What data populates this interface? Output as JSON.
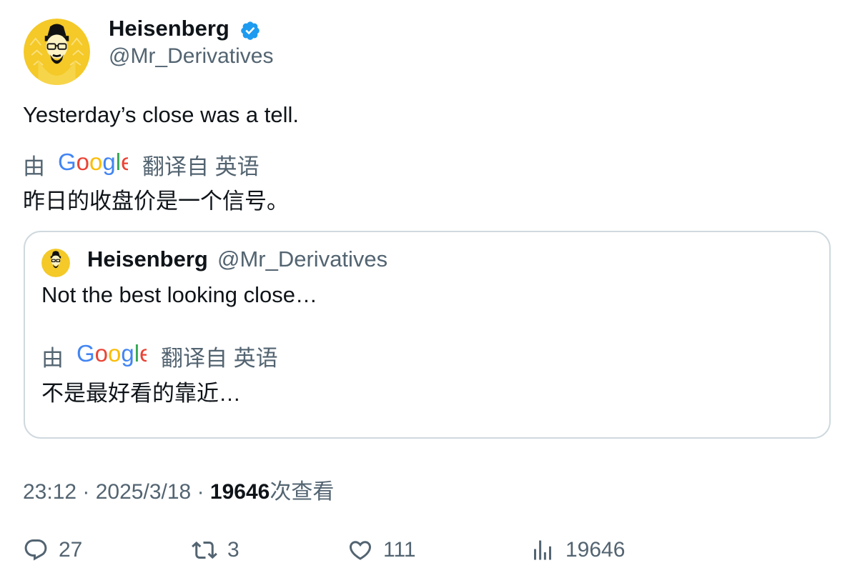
{
  "author": {
    "name": "Heisenberg",
    "handle": "@Mr_Derivatives"
  },
  "tweet": {
    "text": "Yesterday’s close was a tell.",
    "translation": {
      "by_label": "由",
      "provider_logo": "Google",
      "from_label": "翻译自 英语",
      "text": "昨日的收盘价是一个信号。"
    }
  },
  "quote": {
    "name": "Heisenberg",
    "handle": "@Mr_Derivatives",
    "text": "Not the best looking close…",
    "translation": {
      "by_label": "由",
      "provider_logo": "Google",
      "from_label": "翻译自 英语",
      "text": "不是最好看的靠近…"
    }
  },
  "meta": {
    "time": "23:12",
    "sep1": "·",
    "date": "2025/3/18",
    "sep2": "·",
    "views_count": "19646",
    "views_label": "次查看"
  },
  "actions": {
    "replies": "27",
    "retweets": "3",
    "likes": "111",
    "views": "19646"
  },
  "colors": {
    "verified": "#1d9bf0",
    "secondary_text": "#536471",
    "border": "#cfd9de",
    "google_blue": "#4285F4",
    "google_red": "#EA4335",
    "google_yellow": "#FBBC05",
    "google_green": "#34A853"
  },
  "icons": [
    "verified-badge-icon",
    "reply-icon",
    "retweet-icon",
    "like-icon",
    "views-icon"
  ]
}
